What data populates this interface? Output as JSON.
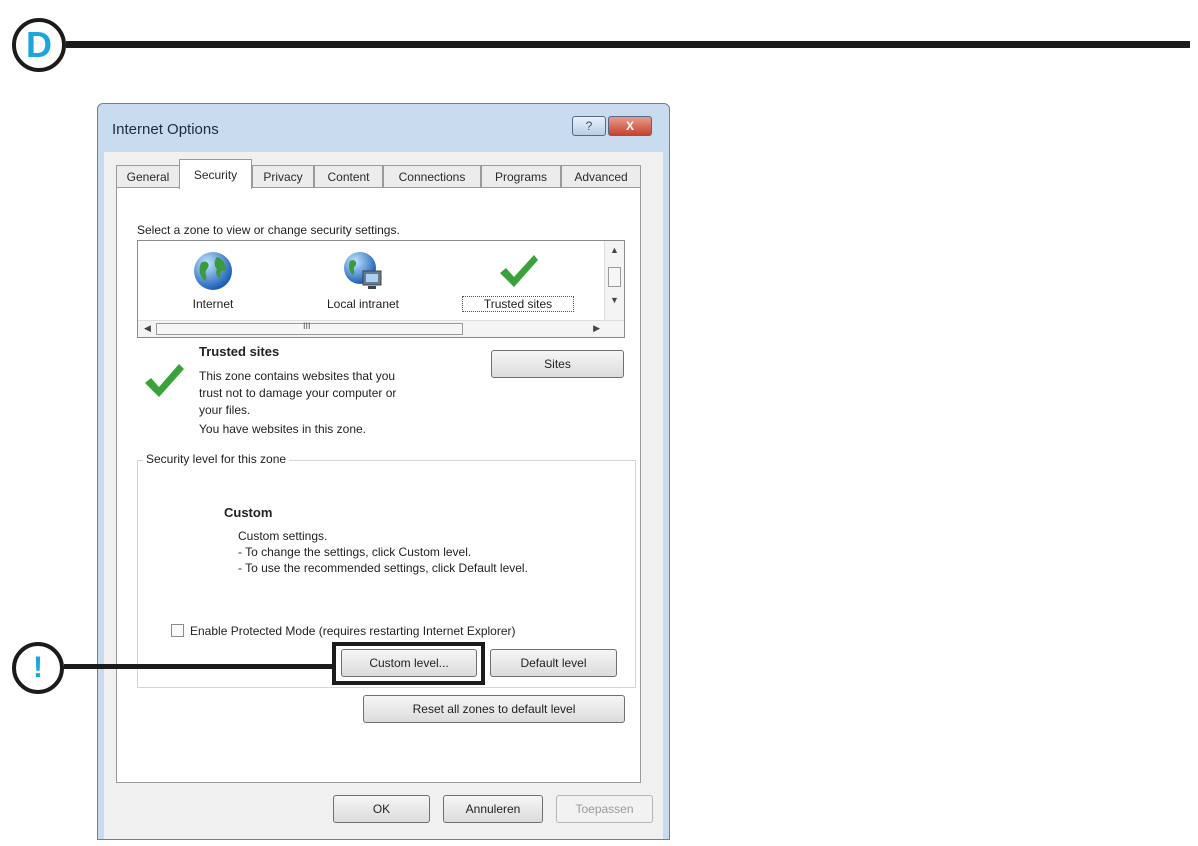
{
  "step": {
    "marker": "D"
  },
  "callout": {
    "marker": "!"
  },
  "window": {
    "title": "Internet Options",
    "help_button": "?",
    "close_button": "X"
  },
  "tabs": [
    "General",
    "Security",
    "Privacy",
    "Content",
    "Connections",
    "Programs",
    "Advanced"
  ],
  "active_tab": "Security",
  "zones": {
    "instruction": "Select a zone to view or change security settings.",
    "items": [
      {
        "label": "Internet",
        "icon": "globe-icon"
      },
      {
        "label": "Local intranet",
        "icon": "intranet-icon"
      },
      {
        "label": "Trusted sites",
        "icon": "checkmark-icon"
      }
    ],
    "selected": "Trusted sites",
    "scroll_marker": "III"
  },
  "zone_info": {
    "title": "Trusted sites",
    "description_lines": [
      "This zone contains websites that you",
      "trust not to damage your computer or",
      "your files.",
      "You have websites in this zone."
    ],
    "sites_button": "Sites"
  },
  "security_level": {
    "legend": "Security level for this zone",
    "level_name": "Custom",
    "lines": [
      "Custom settings.",
      "- To change the settings, click Custom level.",
      "- To use the recommended settings, click Default level."
    ]
  },
  "protected_mode": {
    "label": "Enable Protected Mode (requires restarting Internet Explorer)",
    "checked": false
  },
  "buttons": {
    "custom_level": "Custom level...",
    "default_level": "Default level",
    "reset_all": "Reset all zones to default level",
    "ok": "OK",
    "cancel": "Annuleren",
    "apply": "Toepassen"
  },
  "colors": {
    "accent_marker": "#1aa7df",
    "trusted_check": "#3aa23a",
    "window_frame": "#c9dbee",
    "close_button": "#c64330"
  }
}
